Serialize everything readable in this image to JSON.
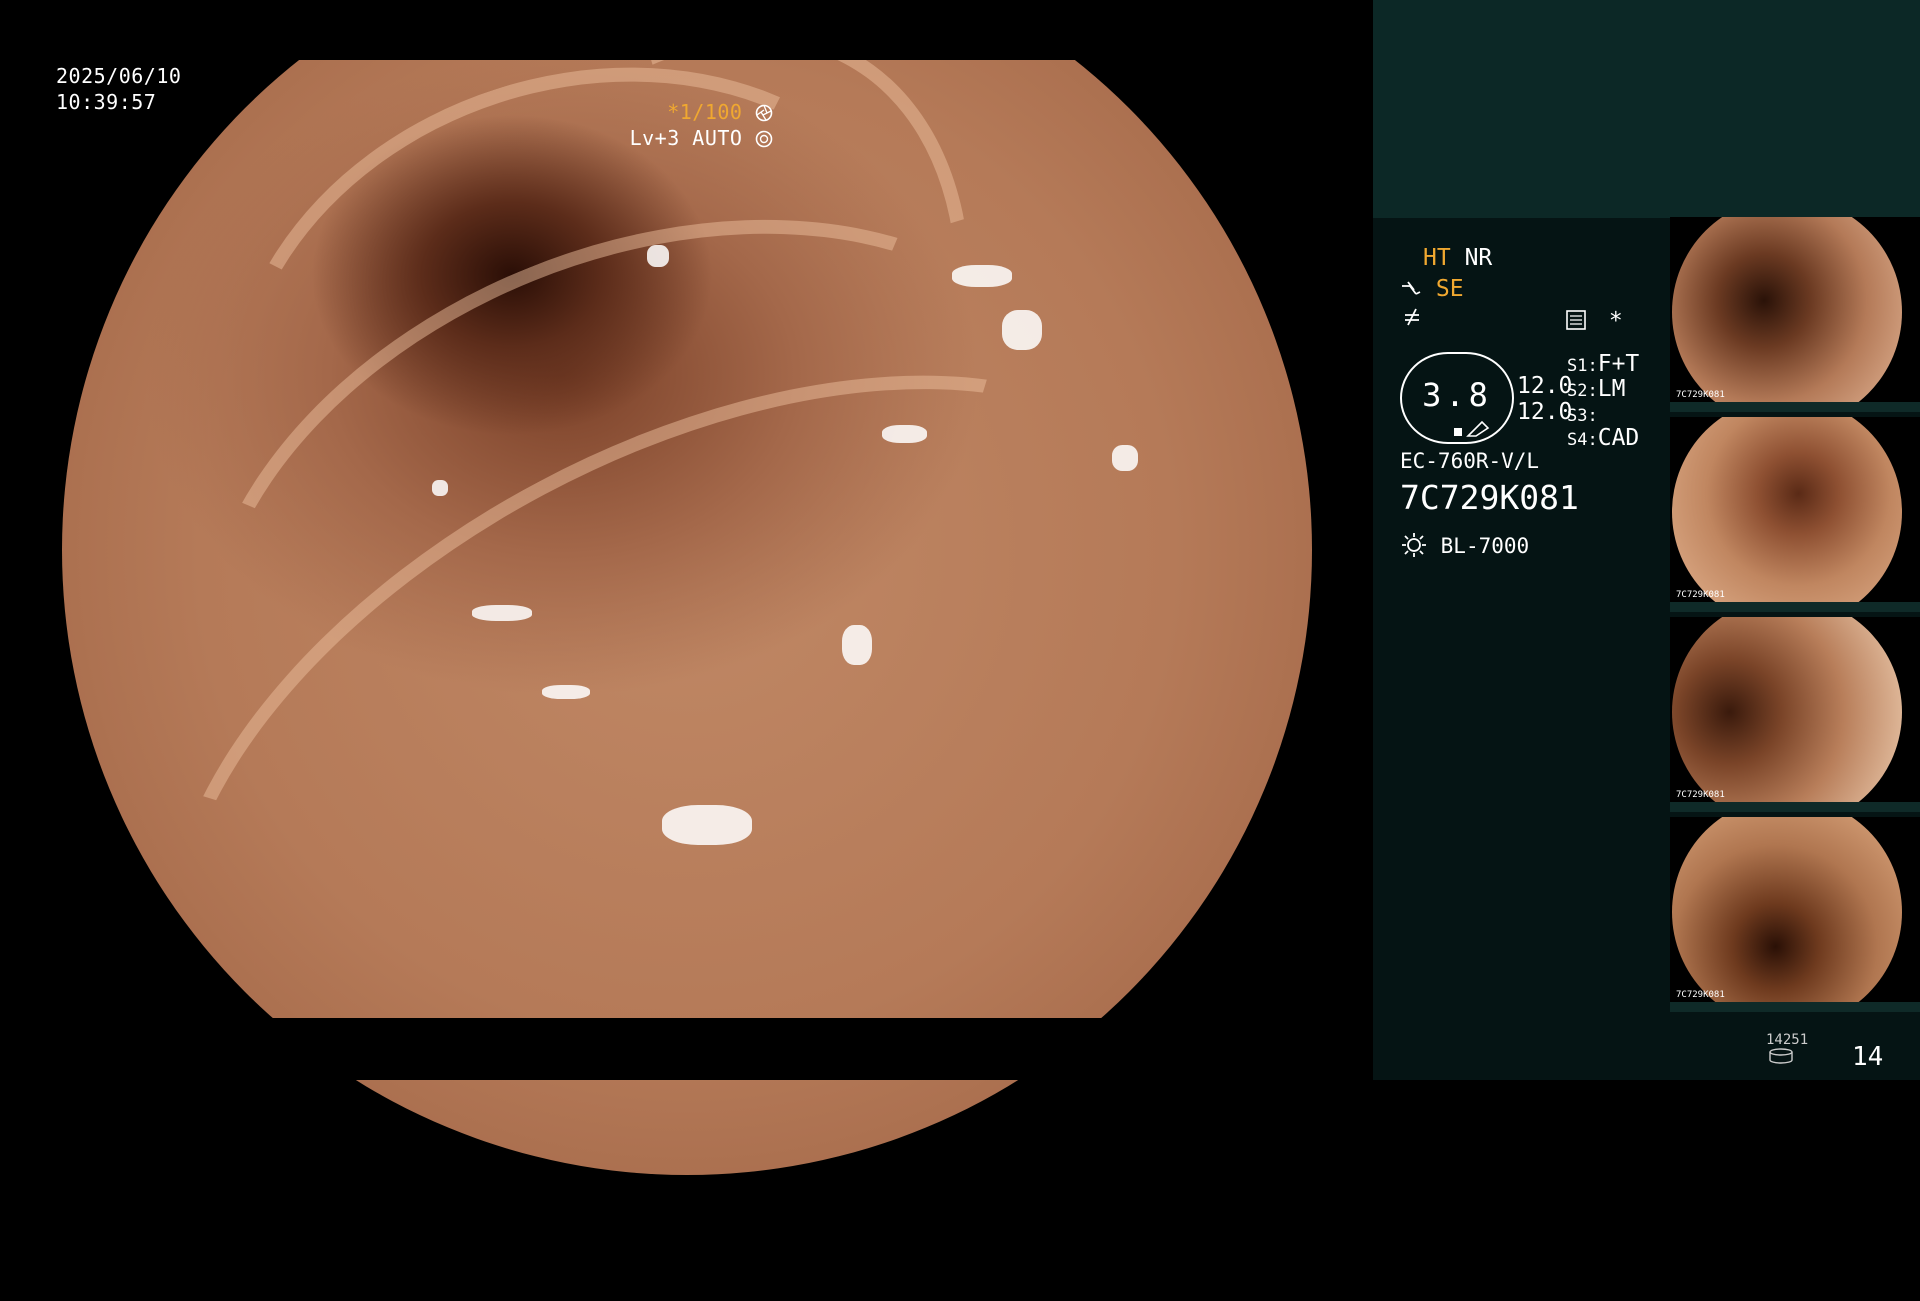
{
  "overlay": {
    "date": "2025/06/10",
    "time": "10:39:57",
    "shutter": "*1/100",
    "level": "Lv+3 AUTO",
    "shutter_icon": "aperture-icon",
    "auto_icon": "iris-icon"
  },
  "panel": {
    "mode_ht": "HT",
    "mode_nr": "NR",
    "mode_se": "SE",
    "se_icon": "hook-icon",
    "freeze_icon": "not-equal-icon",
    "scope_icon": "scope-settings-icon",
    "star": "*",
    "gauge_value": "3.8",
    "value_a": "12.0",
    "value_b": "12.0",
    "s1_label": "S1:",
    "s1_value": "F+T",
    "s2_label": "S2:",
    "s2_value": "LM",
    "s3_label": "S3:",
    "s3_value": "",
    "s4_label": "S4:",
    "s4_value": "CAD",
    "scope_model": "EC-760R-V/L",
    "serial": "7C729K081",
    "light_icon": "sun-icon",
    "light_source": "BL-7000"
  },
  "thumbnails": [
    {
      "label": "7C729K081"
    },
    {
      "label": "7C729K081"
    },
    {
      "label": "7C729K081"
    },
    {
      "label": "7C729K081"
    }
  ],
  "footer": {
    "image_count": "14251",
    "storage_icon": "database-icon",
    "page_number": "14"
  },
  "colors": {
    "accent_orange": "#f0a830",
    "panel_top": "#0c2826",
    "panel_body": "#051414"
  }
}
